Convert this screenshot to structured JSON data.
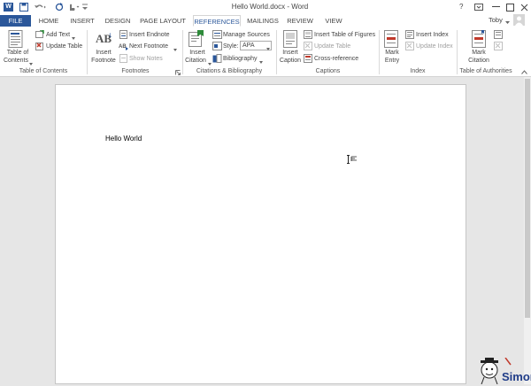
{
  "window": {
    "title": "Hello World.docx - Word",
    "help": "?",
    "user": "Toby"
  },
  "tabs": [
    "FILE",
    "HOME",
    "INSERT",
    "DESIGN",
    "PAGE LAYOUT",
    "REFERENCES",
    "MAILINGS",
    "REVIEW",
    "VIEW"
  ],
  "ribbon": {
    "toc": {
      "table_of_contents": [
        "Table of",
        "Contents"
      ],
      "add_text": "Add Text",
      "update_table": "Update Table",
      "group": "Table of Contents"
    },
    "footnotes": {
      "insert_footnote": [
        "Insert",
        "Footnote"
      ],
      "insert_endnote": "Insert Endnote",
      "next_footnote": "Next Footnote",
      "show_notes": "Show Notes",
      "group": "Footnotes"
    },
    "citations": {
      "insert_citation": [
        "Insert",
        "Citation"
      ],
      "manage_sources": "Manage Sources",
      "style_label": "Style:",
      "style_value": "APA",
      "bibliography": "Bibliography",
      "group": "Citations & Bibliography"
    },
    "captions": {
      "insert_caption": [
        "Insert",
        "Caption"
      ],
      "insert_table_of_figures": "Insert Table of Figures",
      "update_table": "Update Table",
      "cross_reference": "Cross-reference",
      "group": "Captions"
    },
    "index": {
      "mark_entry": [
        "Mark",
        "Entry"
      ],
      "insert_index": "Insert Index",
      "update_index": "Update Index",
      "group": "Index"
    },
    "authorities": {
      "mark_citation": [
        "Mark",
        "Citation"
      ],
      "group": "Table of Authorities"
    }
  },
  "document": {
    "text": "Hello World"
  },
  "watermark": {
    "text": "Simon"
  },
  "colors": {
    "accent": "#2b579a",
    "ribbon_bg": "#ffffff",
    "doc_bg": "#e6e6e6"
  }
}
